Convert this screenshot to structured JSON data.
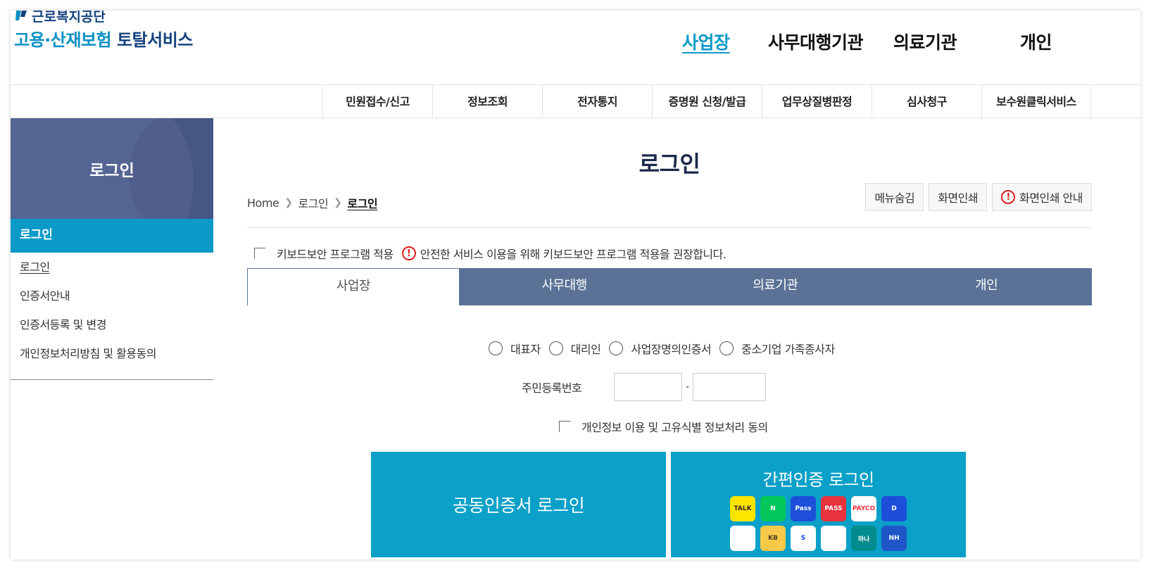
{
  "header": {
    "org_name": "근로복지공단",
    "service_title_part1": "고용·산재보험",
    "service_title_part2": "토탈서비스",
    "gnb": [
      "사업장",
      "사무대행기관",
      "의료기관",
      "개인"
    ],
    "subnav": [
      "민원접수/신고",
      "정보조회",
      "전자통지",
      "증명원 신청/발급",
      "업무상질병판정",
      "심사청구",
      "보수원클릭서비스"
    ]
  },
  "sidebar": {
    "title": "로그인",
    "active": "로그인",
    "items": [
      "로그인",
      "인증서안내",
      "인증서등록 및 변경",
      "개인정보처리방침 및 활용동의"
    ]
  },
  "content": {
    "page_title": "로그인",
    "breadcrumb": {
      "home": "Home",
      "level1": "로그인",
      "current": "로그인"
    },
    "util_buttons": {
      "hide_menu": "메뉴숨김",
      "print": "화면인쇄",
      "print_guide": "화면인쇄 안내"
    },
    "keyboard_security": {
      "checkbox_label": "키보드보안 프로그램 적용",
      "notice": "안전한 서비스 이용을 위해 키보드보안 프로그램 적용을 권장합니다."
    },
    "tabs": [
      "사업장",
      "사무대행",
      "의료기관",
      "개인"
    ],
    "radios": [
      "대표자",
      "대리인",
      "사업장명의인증서",
      "중소기업 가족종사자"
    ],
    "resident_number_label": "주민등록번호",
    "resident_dash": "-",
    "agree_label": "개인정보 이용 및 고유식별 정보처리 동의",
    "cert_login": "공동인증서 로그인",
    "simple_login": "간편인증 로그인",
    "simple_auth_apps": [
      {
        "name": "TALK",
        "bg": "#fee500",
        "fg": "#3c1e1e"
      },
      {
        "name": "N",
        "bg": "#03c75a",
        "fg": "#ffffff"
      },
      {
        "name": "Pass",
        "bg": "#1e4fd8",
        "fg": "#ffffff"
      },
      {
        "name": "PASS",
        "bg": "#e8323c",
        "fg": "#ffffff"
      },
      {
        "name": "PAYCO",
        "bg": "#ffffff",
        "fg": "#e8323c"
      },
      {
        "name": "D",
        "bg": "#1d4ed8",
        "fg": "#ffffff"
      },
      {
        "name": "",
        "bg": "#ffffff",
        "fg": "#1a73e8"
      },
      {
        "name": "KB",
        "bg": "#f7c948",
        "fg": "#4a3d2a"
      },
      {
        "name": "S",
        "bg": "#ffffff",
        "fg": "#0046ff"
      },
      {
        "name": "",
        "bg": "#ffffff",
        "fg": "#00b3a4"
      },
      {
        "name": "하나",
        "bg": "#008c8c",
        "fg": "#ffffff"
      },
      {
        "name": "NH",
        "bg": "#1e56c8",
        "fg": "#ffffff"
      }
    ]
  },
  "colors": {
    "accent": "#0a9ac8",
    "sidebar_head": "#4a5b8d",
    "tab_bg": "#5b7296",
    "warning": "#e02020"
  }
}
